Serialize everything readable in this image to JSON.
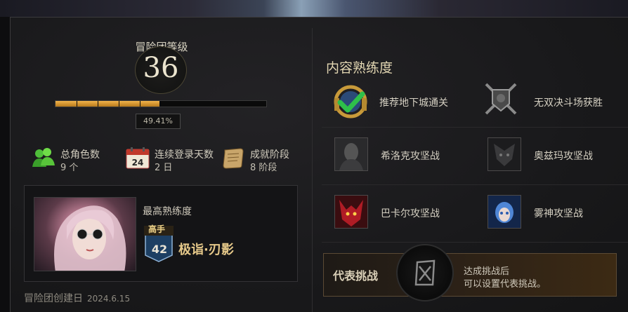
{
  "left": {
    "level_title": "冒险团等级",
    "level": "36",
    "xp_progress_label": "49.41%",
    "xp_progress": 0.4941,
    "stats": [
      {
        "label": "总角色数",
        "value": "9 个",
        "icon": "characters-icon"
      },
      {
        "label": "连续登录天数",
        "value": "2 日",
        "icon": "calendar-icon"
      },
      {
        "label": "成就阶段",
        "value": "8 阶段",
        "icon": "scroll-icon"
      }
    ],
    "character": {
      "best_label": "最高熟练度",
      "rank": "高手",
      "rank_level": "42",
      "name": "极诣·刃影"
    },
    "created_label": "冒险团创建日",
    "created_date": "2024.6.15"
  },
  "right": {
    "title": "内容熟练度",
    "items": [
      {
        "label": "推荐地下城通关",
        "icon": "dungeon-check-icon"
      },
      {
        "label": "无双决斗场获胜",
        "icon": "crossed-swords-shield-icon"
      },
      {
        "label": "希洛克攻坚战",
        "icon": "hilder-portrait-icon"
      },
      {
        "label": "奥兹玛攻坚战",
        "icon": "ozma-portrait-icon"
      },
      {
        "label": "巴卡尔攻坚战",
        "icon": "bakal-portrait-icon"
      },
      {
        "label": "雾神攻坚战",
        "icon": "mist-god-portrait-icon"
      }
    ],
    "challenge": {
      "title": "代表挑战",
      "desc_line1": "达成挑战后",
      "desc_line2": "可以设置代表挑战。"
    }
  },
  "colors": {
    "xp_fill": "#f0b24b",
    "accent_gold": "#e6c98a",
    "check_green": "#2ec04a"
  }
}
